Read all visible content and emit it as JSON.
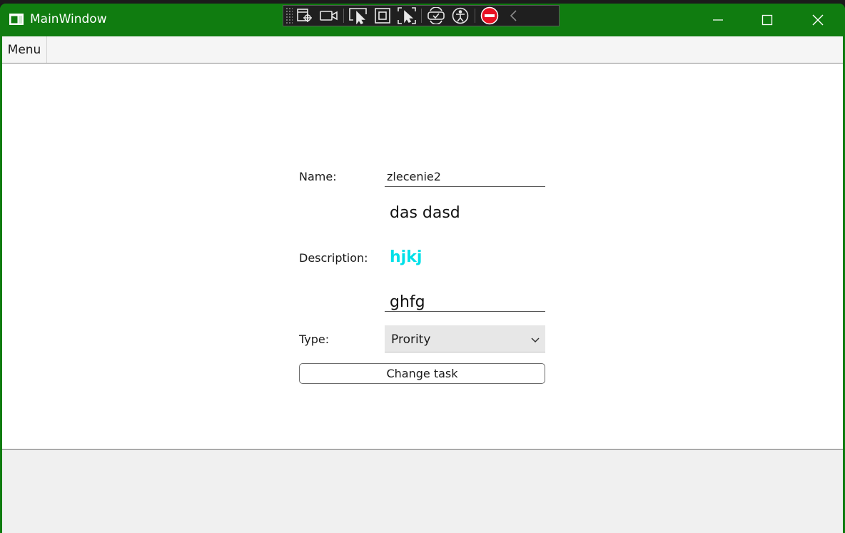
{
  "window": {
    "title": "MainWindow",
    "accent_color": "#107c10",
    "controls": [
      "minimize-icon",
      "maximize-icon",
      "close-icon"
    ]
  },
  "dev_toolbar": {
    "tools": [
      "select-element-icon",
      "record-video-icon",
      "pointer-icon",
      "layout-adorner-icon",
      "track-focus-icon",
      "hot-reload-icon",
      "accessibility-icon",
      "stop-icon",
      "collapse-chevron-icon"
    ]
  },
  "menu": {
    "label": "Menu"
  },
  "form": {
    "name_label": "Name:",
    "name_value": "zlecenie2",
    "description_label": "Description:",
    "description_lines": [
      "das dasd",
      "hjkj",
      "ghfg"
    ],
    "description_highlight_color": "#00e0e8",
    "type_label": "Type:",
    "type_value": "Prority",
    "submit_label": "Change task"
  }
}
